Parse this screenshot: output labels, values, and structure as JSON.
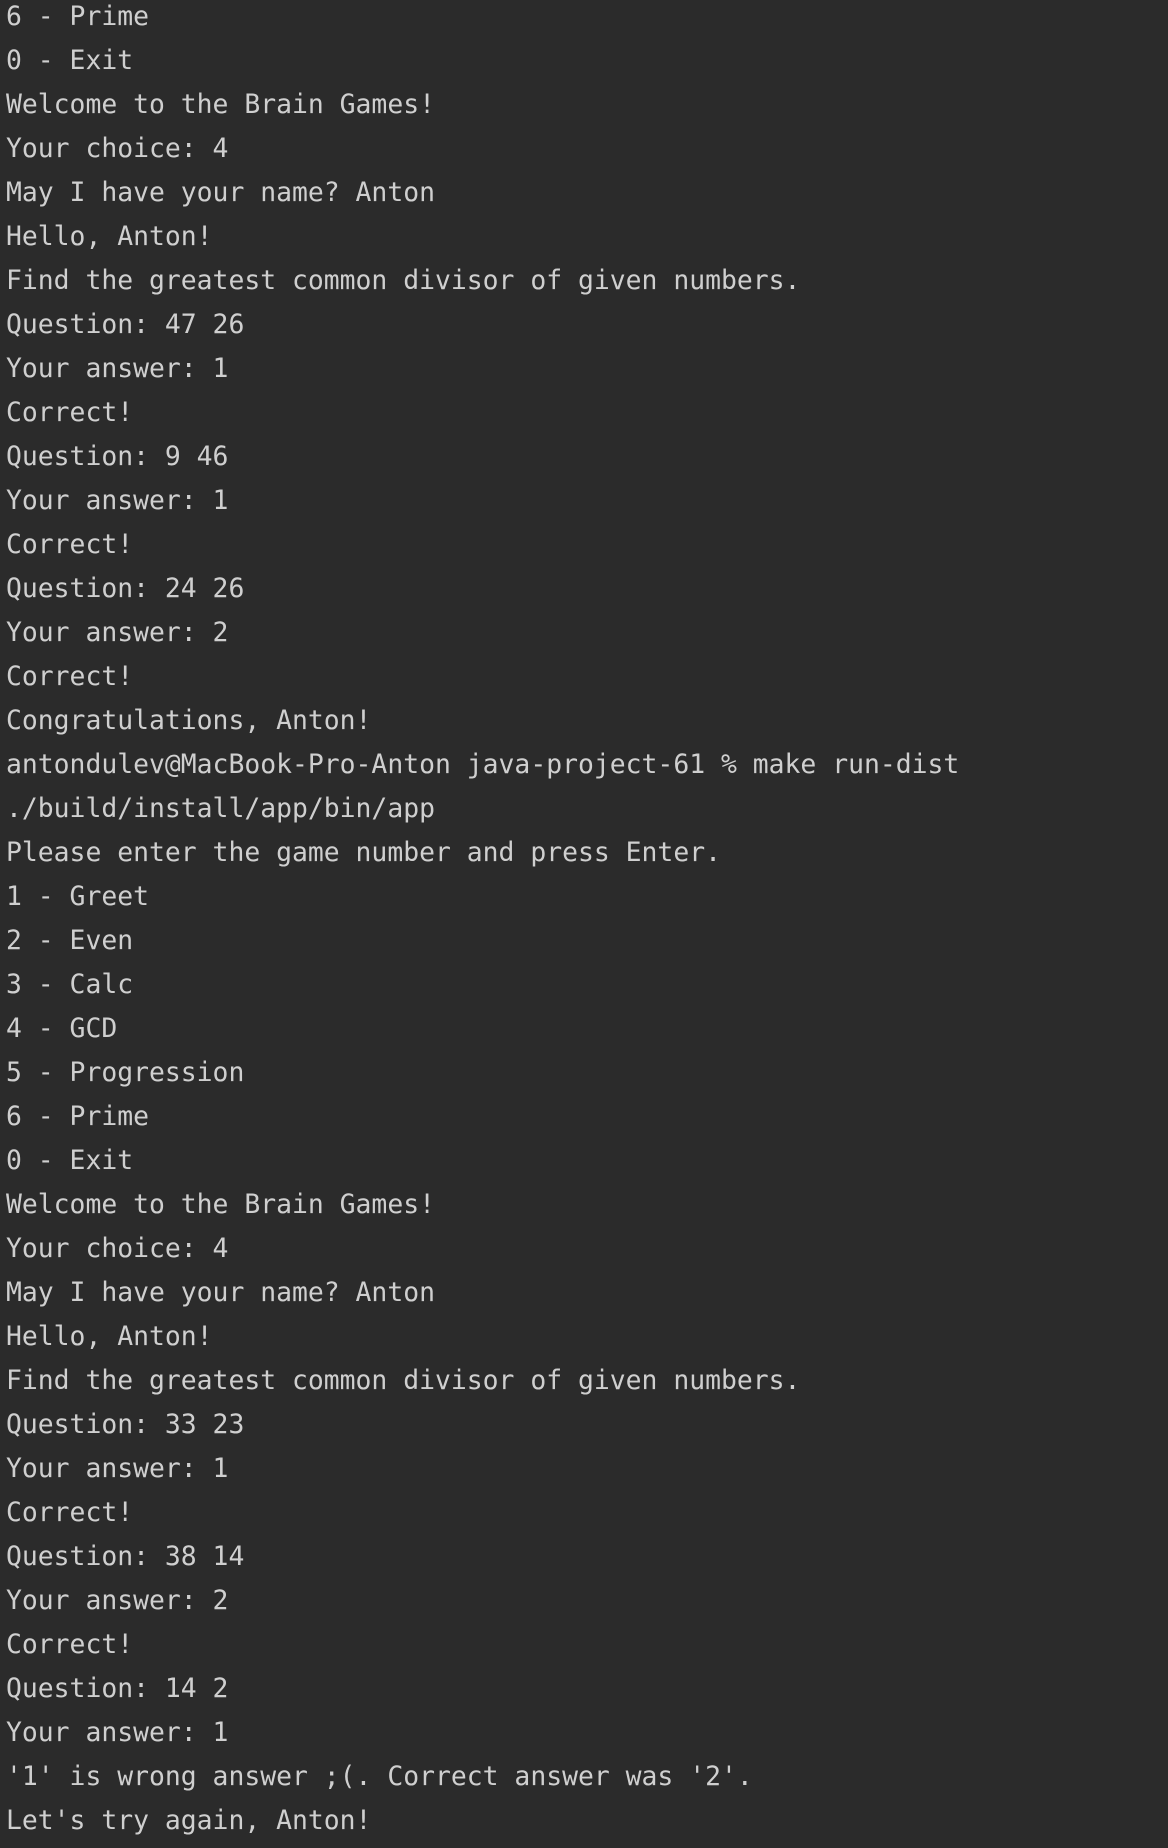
{
  "terminal": {
    "lines": [
      "6 - Prime",
      "0 - Exit",
      "Welcome to the Brain Games!",
      "Your choice: 4",
      "May I have your name? Anton",
      "Hello, Anton!",
      "Find the greatest common divisor of given numbers.",
      "Question: 47 26",
      "Your answer: 1",
      "Correct!",
      "Question: 9 46",
      "Your answer: 1",
      "Correct!",
      "Question: 24 26",
      "Your answer: 2",
      "Correct!",
      "Congratulations, Anton!",
      "antondulev@MacBook-Pro-Anton java-project-61 % make run-dist",
      "./build/install/app/bin/app",
      "Please enter the game number and press Enter.",
      "1 - Greet",
      "2 - Even",
      "3 - Calc",
      "4 - GCD",
      "5 - Progression",
      "6 - Prime",
      "0 - Exit",
      "Welcome to the Brain Games!",
      "Your choice: 4",
      "May I have your name? Anton",
      "Hello, Anton!",
      "Find the greatest common divisor of given numbers.",
      "Question: 33 23",
      "Your answer: 1",
      "Correct!",
      "Question: 38 14",
      "Your answer: 2",
      "Correct!",
      "Question: 14 2",
      "Your answer: 1",
      "'1' is wrong answer ;(. Correct answer was '2'.",
      "Let's try again, Anton!"
    ],
    "colors": {
      "background": "#2b2b2b",
      "text": "#cfcfcf"
    }
  }
}
